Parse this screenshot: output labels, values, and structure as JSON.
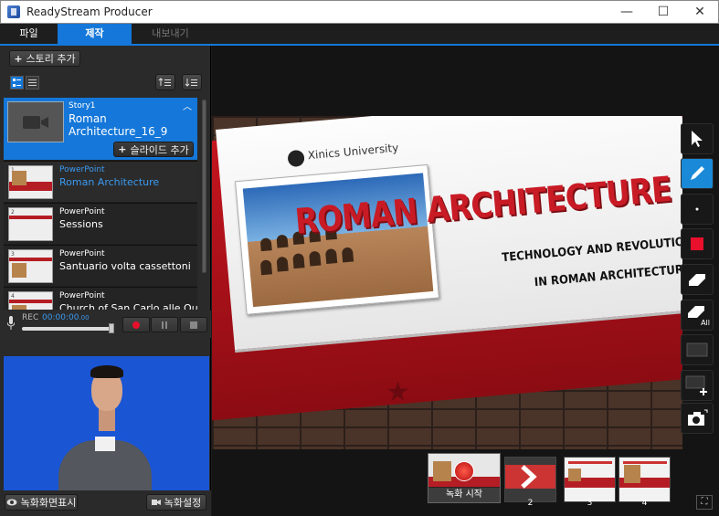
{
  "window": {
    "title": "ReadyStream Producer",
    "minimize_glyph": "—",
    "maximize_glyph": "☐",
    "close_glyph": "✕"
  },
  "menu": {
    "tabs": [
      {
        "label": "파일"
      },
      {
        "label": "제작",
        "active": true
      },
      {
        "label": "내보내기"
      }
    ]
  },
  "story_panel": {
    "add_story_label": "스토리 추가",
    "story": {
      "label": "Story1",
      "name": "Roman Architecture_16_9",
      "add_slide_label": "슬라이드 추가"
    },
    "slides": [
      {
        "number": "1",
        "type": "PowerPoint",
        "title": "Roman Architecture",
        "selected": true
      },
      {
        "number": "2",
        "type": "PowerPoint",
        "title": "Sessions"
      },
      {
        "number": "3",
        "type": "PowerPoint",
        "title": "Santuario volta cassettoni"
      },
      {
        "number": "4",
        "type": "PowerPoint",
        "title": "Church of San Carlo alle Quattro"
      }
    ]
  },
  "recorder": {
    "label": "REC",
    "time": "00:00:00",
    "time_fraction": ".00",
    "progress": 0.95
  },
  "bottom": {
    "show_recording_label": "녹화화면표시",
    "recording_settings_label": "녹화설정"
  },
  "slide_content": {
    "university": "Xinics University",
    "heading": "ROMAN ARCHITECTURE",
    "subtitle1": "TECHNOLOGY AND REVOLUTION",
    "subtitle2": "IN ROMAN ARCHITECTURE"
  },
  "tools": [
    {
      "name": "pointer-tool-icon"
    },
    {
      "name": "pen-tool-icon",
      "active": true
    },
    {
      "name": "pen-size-icon"
    },
    {
      "name": "pen-color-icon",
      "color": "#e8102c"
    },
    {
      "name": "eraser-icon"
    },
    {
      "name": "erase-all-icon",
      "label": "All"
    },
    {
      "name": "blank-board-icon"
    },
    {
      "name": "add-board-icon"
    },
    {
      "name": "capture-icon"
    }
  ],
  "thumbnails": {
    "record_start_label": "녹화 시작",
    "items": [
      {
        "number": "2"
      },
      {
        "number": "3"
      },
      {
        "number": "4"
      }
    ]
  },
  "colors": {
    "accent": "#1477d9",
    "record_red": "#e8102c"
  }
}
